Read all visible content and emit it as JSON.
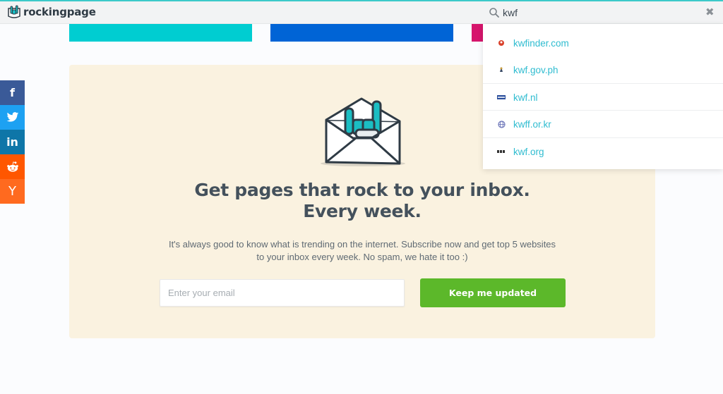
{
  "header": {
    "brand": "rockingpage",
    "search": {
      "value": "kwf",
      "placeholder": ""
    }
  },
  "social": {
    "items": [
      {
        "name": "facebook",
        "glyph": "f"
      },
      {
        "name": "twitter",
        "glyph": "t"
      },
      {
        "name": "linkedin",
        "glyph": "in"
      },
      {
        "name": "reddit",
        "glyph": "r"
      },
      {
        "name": "hacker-news",
        "glyph": "Y"
      }
    ]
  },
  "newsletter": {
    "headline_line1": "Get pages that rock to your inbox.",
    "headline_line2": "Every week.",
    "subtext_line1": "It's always good to know what is trending on the internet. Subscribe now and get top 5 websites",
    "subtext_line2": "to your inbox every week. No spam, we hate it too :)",
    "email_placeholder": "Enter your email",
    "button_label": "Keep me updated"
  },
  "suggestions": [
    {
      "label": "kwfinder.com",
      "favicon": "red-bug-icon"
    },
    {
      "label": "kwf.gov.ph",
      "favicon": "seal-icon"
    },
    {
      "label": "kwf.nl",
      "favicon": "blue-logo-icon"
    },
    {
      "label": "kwff.or.kr",
      "favicon": "globe-icon"
    },
    {
      "label": "kwf.org",
      "favicon": "kwf-text-icon"
    }
  ],
  "colors": {
    "accent_teal": "#3cc9c9",
    "link": "#2fbcd0",
    "button_green": "#5cb82a",
    "card_bg": "#faf2e0",
    "strip_cyan": "#00cdd1",
    "strip_blue": "#0064d6",
    "strip_pink": "#d6156c"
  }
}
